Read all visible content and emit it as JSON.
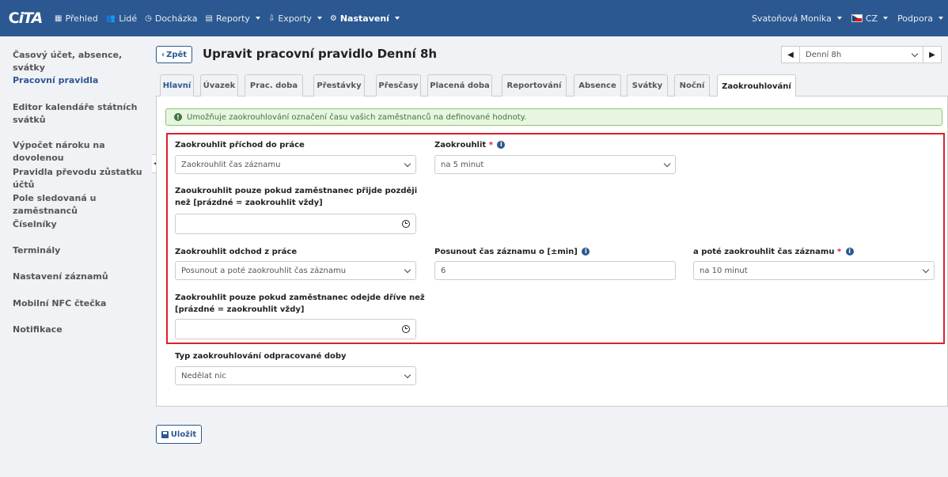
{
  "navbar": {
    "logo_c": "C",
    "logo_t": "iTA",
    "items": [
      {
        "label": "Přehled",
        "icon": "grid-icon"
      },
      {
        "label": "Lidé",
        "icon": "users-icon"
      },
      {
        "label": "Docházka",
        "icon": "clock-icon"
      },
      {
        "label": "Reporty",
        "icon": "print-icon"
      },
      {
        "label": "Exporty",
        "icon": "export-icon"
      },
      {
        "label": "Nastavení",
        "icon": "gear-icon"
      }
    ],
    "user": "Svatoňová Monika",
    "language": "CZ",
    "support": "Podpora"
  },
  "sidebar": {
    "items": [
      {
        "label": "Časový účet, absence, svátky"
      },
      {
        "label": "Pracovní pravidla"
      },
      {
        "label": "Editor kalendáře státních svátků"
      },
      {
        "label": "Výpočet nároku na dovolenou"
      },
      {
        "label": "Pravidla převodu zůstatku účtů"
      },
      {
        "label": "Pole sledovaná u zaměstnanců"
      },
      {
        "label": "Číselníky"
      },
      {
        "label": "Terminály"
      },
      {
        "label": "Nastavení záznamů"
      },
      {
        "label": "Mobilní NFC čtečka"
      },
      {
        "label": "Notifikace"
      }
    ]
  },
  "header": {
    "back_label": "Zpět",
    "title": "Upravit pracovní pravidlo Denní 8h",
    "rule_select": "Denní 8h"
  },
  "tabs": [
    {
      "label": "Hlavní"
    },
    {
      "label": "Úvazek"
    },
    {
      "label": "Prac. doba"
    },
    {
      "label": "Přestávky"
    },
    {
      "label": "Přesčasy"
    },
    {
      "label": "Placená doba"
    },
    {
      "label": "Reportování"
    },
    {
      "label": "Absence"
    },
    {
      "label": "Svátky"
    },
    {
      "label": "Noční"
    },
    {
      "label": "Zaokrouhlování"
    }
  ],
  "info": "Umožňuje zaokrouhlování označení času vašich zaměstnanců na definované hodnoty.",
  "form": {
    "arrival": {
      "label": "Zaokrouhlit příchod do práce",
      "value": "Zaokrouhlit čas záznamu",
      "round_label": "Zaokrouhlit",
      "round_value": "na 5 minut",
      "only_if_label_1": "Zaoukrouhlit pouze pokud zaměstnanec přijde později",
      "only_if_label_2": "než [prázdné = zaokrouhlit vždy]",
      "only_if_value": ""
    },
    "departure": {
      "label": "Zaokrouhlit odchod z práce",
      "value": "Posunout a poté zaokrouhlit čas záznamu",
      "shift_label": "Posunout čas záznamu o [±min]",
      "shift_value": "6",
      "then_label": "a poté zaokrouhlit čas záznamu",
      "then_value": "na 10 minut",
      "only_if_label_1": "Zaokrouhlit pouze pokud zaměstnanec odejde dříve než",
      "only_if_label_2": "[prázdné = zaokrouhlit vždy]",
      "only_if_value": ""
    },
    "worktime": {
      "label": "Typ zaokrouhlování odpracované doby",
      "value": "Nedělat nic"
    }
  },
  "save_label": "Uložit",
  "colors": {
    "navbar": "#2b5890",
    "accent": "#2b5890",
    "highlight_border": "#d9222a",
    "info_bg": "#e8f5e0"
  }
}
